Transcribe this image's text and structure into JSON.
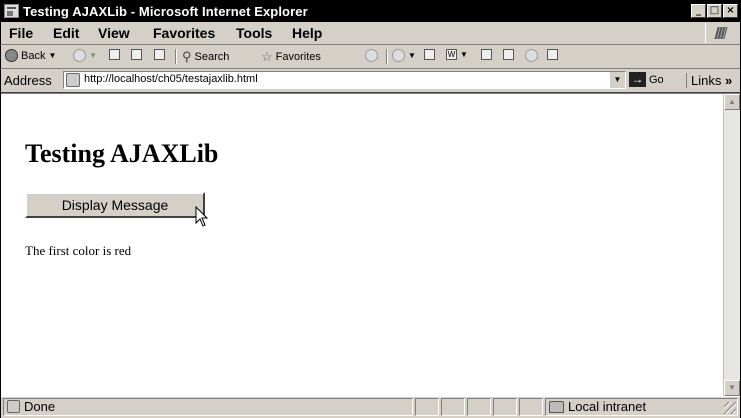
{
  "window": {
    "title": "Testing AJAXLib - Microsoft Internet Explorer",
    "controls": [
      "_",
      "□",
      "×"
    ]
  },
  "menu": [
    "File",
    "Edit",
    "View",
    "Favorites",
    "Tools",
    "Help"
  ],
  "toolbar": {
    "back_label": "Back",
    "search_label": "Search",
    "favorites_label": "Favorites"
  },
  "address": {
    "label": "Address",
    "url": "http://localhost/ch05/testajaxlib.html",
    "go_label": "Go",
    "links_label": "Links"
  },
  "page": {
    "heading": "Testing AJAXLib",
    "button_label": "Display Message",
    "message": "The first color is red"
  },
  "status": {
    "text": "Done",
    "zone": "Local intranet"
  },
  "icons": [
    "ie-page-icon",
    "back-icon",
    "forward-icon",
    "stop-icon",
    "refresh-icon",
    "home-icon",
    "search-icon",
    "favorites-star-icon",
    "media-icon",
    "mail-icon",
    "print-icon",
    "edit-icon",
    "discuss-icon",
    "messenger-icon",
    "go-arrow-icon",
    "cursor-icon",
    "local-intranet-icon",
    "windows-logo-icon"
  ]
}
